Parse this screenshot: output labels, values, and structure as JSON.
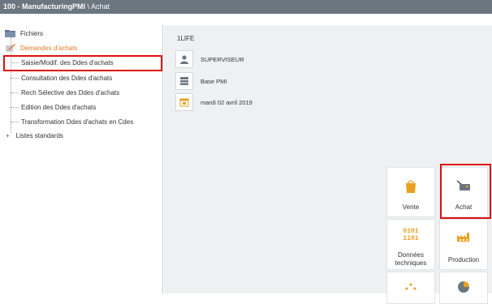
{
  "title_bar": {
    "main": "100 - ManufacturingPMI",
    "sub": " \\ Achat"
  },
  "sidebar": {
    "fichiers": "Fichiers",
    "demandes": "Demandes d'achats",
    "children": [
      "Saisie/Modif. des Ddes d'achats",
      "Consultation des Ddes d'achats",
      "Rech Sélective des Ddes d'achats",
      "Edition des Ddes d'achats",
      "Transformation Ddes d'achats en Cdes"
    ],
    "listes": "Listes standards",
    "expand_symbol": "+"
  },
  "main": {
    "company": "1LIFE",
    "user": "SUPERVISEUR",
    "database": "Base PMI",
    "date": "mardi 02 avril 2019"
  },
  "tiles": {
    "vente": "Vente",
    "achat": "Achat",
    "donnees_line1": "Données",
    "donnees_line2": "techniques",
    "donnees_bin1": "0101",
    "donnees_bin2": "1101",
    "production": "Production"
  },
  "colors": {
    "accent_orange": "#e8a020",
    "highlight_red": "#e01010",
    "titlebar": "#6a7680"
  },
  "icons": {
    "fichiers": "folder-icon",
    "demandes": "cart-edit-icon",
    "user": "user-icon",
    "database": "database-icon",
    "date": "calendar-icon",
    "vente": "shopping-bag-icon",
    "achat": "credit-card-icon",
    "production": "factory-icon"
  }
}
